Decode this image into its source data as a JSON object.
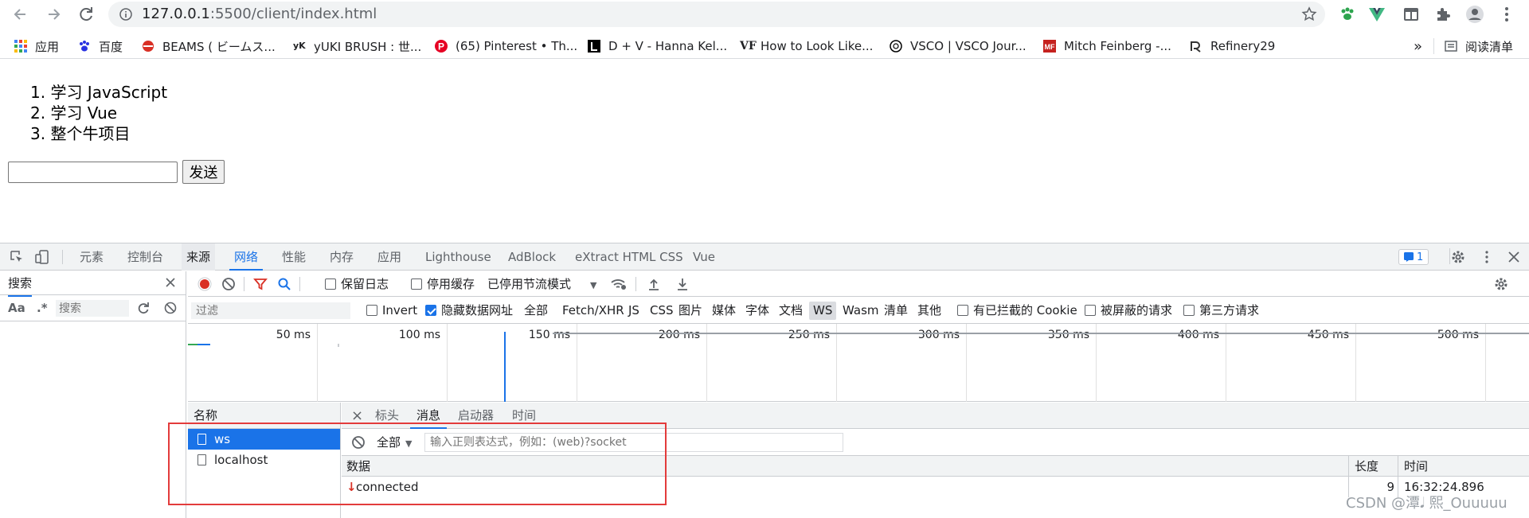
{
  "browser": {
    "url_host": "127.0.0.1",
    "url_path": ":5500/client/index.html",
    "bookmarks": [
      {
        "label": "应用",
        "icon": "apps-grid-icon",
        "color": "#4285f4"
      },
      {
        "label": "百度",
        "icon": "baidu-paw-icon",
        "color": "#2932e1"
      },
      {
        "label": "BEAMS ( ビームス...",
        "icon": "beams-icon",
        "color": "#d93025"
      },
      {
        "label": "yUKI BRUSH : 世...",
        "icon": "yuki-brush-icon",
        "color": "#000000"
      },
      {
        "label": "(65) Pinterest • Th...",
        "icon": "pinterest-icon",
        "color": "#e60023"
      },
      {
        "label": "D + V - Hanna Kel...",
        "icon": "letter-l-icon",
        "color": "#000000"
      },
      {
        "label": "How to Look Like...",
        "icon": "vanity-fair-icon",
        "color": "#000000"
      },
      {
        "label": "VSCO | VSCO Jour...",
        "icon": "vsco-icon",
        "color": "#000000"
      },
      {
        "label": "Mitch Feinberg -...",
        "icon": "mf-icon",
        "color": "#c5221f"
      },
      {
        "label": "Refinery29",
        "icon": "refinery29-icon",
        "color": "#333333"
      }
    ],
    "more_label": "»",
    "reading_list": "阅读清单"
  },
  "page": {
    "todos": [
      "1. 学习 JavaScript",
      "2. 学习 Vue",
      "3. 整个牛项目"
    ],
    "input_value": "",
    "send_label": "发送"
  },
  "devtools": {
    "tabs": [
      "元素",
      "控制台",
      "来源",
      "网络",
      "性能",
      "内存",
      "应用",
      "Lighthouse",
      "AdBlock",
      "eXtract HTML CSS",
      "Vue"
    ],
    "active_tab": "网络",
    "issues_count": "1",
    "search": {
      "title": "搜索",
      "aa": "Aa",
      "regex": ".*",
      "placeholder": "搜索"
    },
    "network_toolbar": {
      "preserve_log": "保留日志",
      "disable_cache": "停用缓存",
      "throttling": "已停用节流模式"
    },
    "filter": {
      "placeholder": "过滤",
      "invert": "Invert",
      "hide_data_urls": "隐藏数据网址",
      "types": [
        "全部",
        "Fetch/XHR",
        "JS",
        "CSS",
        "图片",
        "媒体",
        "字体",
        "文档",
        "WS",
        "Wasm",
        "清单",
        "其他"
      ],
      "selected_type": "WS",
      "blocked_cookies": "有已拦截的 Cookie",
      "blocked_requests": "被屏蔽的请求",
      "third_party": "第三方请求"
    },
    "timeline_ticks": [
      "50 ms",
      "100 ms",
      "150 ms",
      "200 ms",
      "250 ms",
      "300 ms",
      "350 ms",
      "400 ms",
      "450 ms",
      "500 ms"
    ],
    "requests": {
      "header": "名称",
      "items": [
        "ws",
        "localhost"
      ],
      "selected": "ws"
    },
    "detail": {
      "close": "×",
      "tabs": [
        "标头",
        "消息",
        "启动器",
        "时间"
      ],
      "selected_tab": "消息",
      "filter_all": "全部",
      "filter_placeholder": "输入正则表达式，例如：(web)?socket",
      "columns": {
        "data": "数据",
        "length": "长度",
        "time": "时间"
      },
      "messages": [
        {
          "direction": "↓",
          "data": "connected",
          "length": "9",
          "time": "16:32:24.896"
        }
      ]
    }
  },
  "watermark": "CSDN @潭𝅘𝅥 熙_Ouuuuu"
}
